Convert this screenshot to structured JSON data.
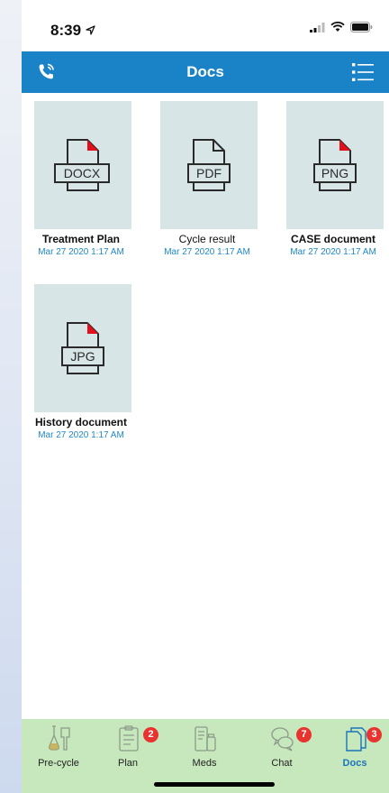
{
  "status_bar": {
    "time": "8:39"
  },
  "header": {
    "title": "Docs"
  },
  "documents": [
    {
      "title": "Treatment Plan",
      "date": "Mar 27 2020  1:17 AM",
      "type": "DOCX",
      "bold": true
    },
    {
      "title": "Cycle result",
      "date": "Mar 27 2020  1:17 AM",
      "type": "PDF",
      "bold": false
    },
    {
      "title": "CASE document",
      "date": "Mar 27 2020  1:17 AM",
      "type": "PNG",
      "bold": true
    },
    {
      "title": "History document",
      "date": "Mar 27 2020  1:17 AM",
      "type": "JPG",
      "bold": true
    }
  ],
  "tabs": [
    {
      "label": "Pre-cycle",
      "icon": "pre-cycle-icon",
      "badge": null
    },
    {
      "label": "Plan",
      "icon": "plan-icon",
      "badge": "2"
    },
    {
      "label": "Meds",
      "icon": "meds-icon",
      "badge": null
    },
    {
      "label": "Chat",
      "icon": "chat-icon",
      "badge": "7"
    },
    {
      "label": "Docs",
      "icon": "docs-icon",
      "badge": "3",
      "active": true
    }
  ],
  "colors": {
    "header": "#1a83c7",
    "tabbar": "#c7e8bd",
    "badge": "#e8332f",
    "date": "#1f88c9",
    "thumb": "#d8e5e7"
  }
}
